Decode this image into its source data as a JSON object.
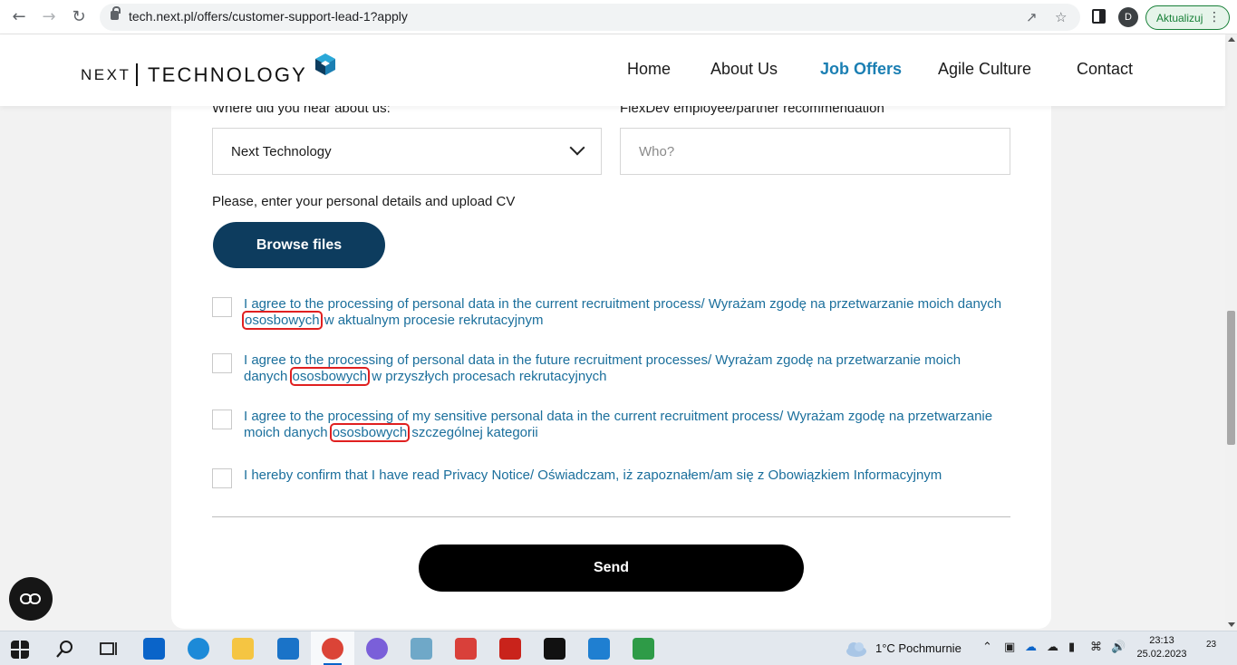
{
  "browser": {
    "url": "tech.next.pl/offers/customer-support-lead-1?apply",
    "profile_initial": "D",
    "update_label": "Aktualizuj"
  },
  "header": {
    "logo_left": "NEXT",
    "logo_right": "TECHNOLOGY",
    "nav": [
      {
        "label": "Home",
        "active": false
      },
      {
        "label": "About Us",
        "active": false
      },
      {
        "label": "Job Offers",
        "active": true
      },
      {
        "label": "Agile Culture",
        "active": false
      },
      {
        "label": "Contact",
        "active": false
      }
    ]
  },
  "form": {
    "source_label": "Where did you hear about us:",
    "source_value": "Next Technology",
    "recommendation_label": "FlexDev employee/partner recommendation",
    "recommendation_placeholder": "Who?",
    "upload_label": "Please, enter your personal details and upload CV",
    "browse_label": "Browse files",
    "consents": [
      {
        "before": "I agree to the processing of personal data in the current recruitment process/ Wyrażam zgodę na przetwarzanie moich danych ",
        "highlight": "ososbowych",
        "after": " w aktualnym procesie rekrutacyjnym"
      },
      {
        "before": "I agree to the processing of personal data in the future recruitment processes/ Wyrażam zgodę na przetwarzanie moich danych ",
        "highlight": "ososbowych",
        "after": " w przyszłych procesach rekrutacyjnych"
      },
      {
        "before": "I agree to the processing of my sensitive personal data in the current recruitment process/ Wyrażam zgodę na przetwarzanie moich danych ",
        "highlight": "ososbowych",
        "after": " szczególnej kategorii"
      },
      {
        "before": "I hereby confirm that I have read Privacy Notice/ Oświadczam, iż zapoznałem/am się z Obowiązkiem Informacyjnym",
        "highlight": "",
        "after": ""
      }
    ],
    "send_label": "Send"
  },
  "taskbar": {
    "weather": "1°C  Pochmurnie",
    "time": "23:13",
    "date": "25.02.2023",
    "notifications": "23"
  },
  "colors": {
    "accent": "#1b7fb3",
    "consent_text": "#1b6f9c",
    "browse_button": "#0d3c5e",
    "send_button": "#000000",
    "highlight": "#e02020"
  }
}
